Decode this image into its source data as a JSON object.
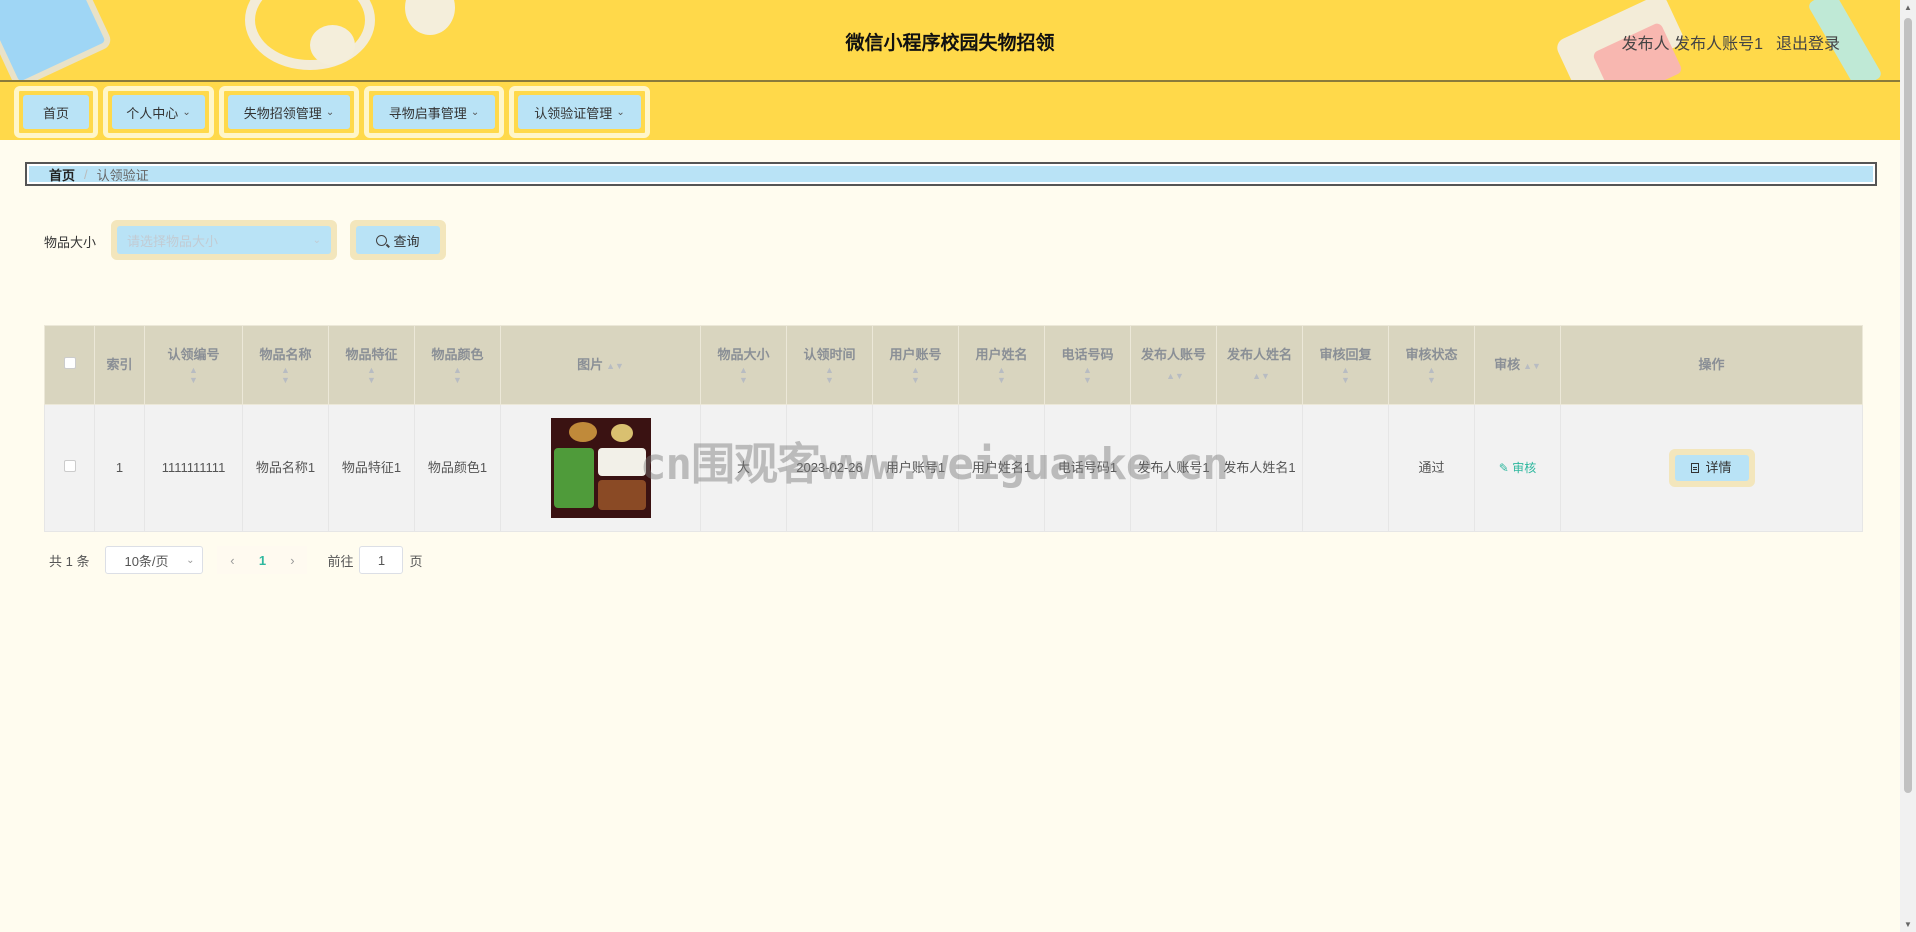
{
  "header": {
    "title": "微信小程序校园失物招领",
    "user": "发布人 发布人账号1",
    "logout": "退出登录"
  },
  "nav": {
    "items": [
      {
        "label": "首页",
        "dropdown": false
      },
      {
        "label": "个人中心",
        "dropdown": true
      },
      {
        "label": "失物招领管理",
        "dropdown": true
      },
      {
        "label": "寻物启事管理",
        "dropdown": true
      },
      {
        "label": "认领验证管理",
        "dropdown": true
      }
    ]
  },
  "breadcrumb": {
    "home": "首页",
    "separator": "/",
    "current": "认领验证"
  },
  "search": {
    "label": "物品大小",
    "placeholder": "请选择物品大小",
    "button": "查询"
  },
  "table": {
    "headers": {
      "index": "索引",
      "claim_no": "认领编号",
      "item_name": "物品名称",
      "item_feature": "物品特征",
      "item_color": "物品颜色",
      "image": "图片",
      "item_size": "物品大小",
      "claim_time": "认领时间",
      "user_account": "用户账号",
      "user_name": "用户姓名",
      "phone": "电话号码",
      "publisher_account": "发布人账号",
      "publisher_name": "发布人姓名",
      "audit_reply": "审核回复",
      "audit_status": "审核状态",
      "audit": "审核",
      "actions": "操作"
    },
    "rows": [
      {
        "index": "1",
        "claim_no": "1111111111",
        "item_name": "物品名称1",
        "item_feature": "物品特征1",
        "item_color": "物品颜色1",
        "item_size": "大",
        "claim_time": "2023-02-26",
        "user_account": "用户账号1",
        "user_name": "用户姓名1",
        "phone": "电话号码1",
        "publisher_account": "发布人账号1",
        "publisher_name": "发布人姓名1",
        "audit_reply": "",
        "audit_status": "通过",
        "audit_link": "审核",
        "detail_button": "详情"
      }
    ]
  },
  "pagination": {
    "total": "共 1 条",
    "page_size": "10条/页",
    "current_page": "1",
    "goto_label": "前往",
    "goto_value": "1",
    "page_suffix": "页"
  },
  "watermark": "cn围观客www.weiguanke.cn",
  "colors": {
    "header_bg": "#ffd94a",
    "button_bg": "#b9e3f6",
    "page_bg": "#fffcef",
    "table_header_bg": "#d9d5bf",
    "accent": "#2fb89f"
  }
}
